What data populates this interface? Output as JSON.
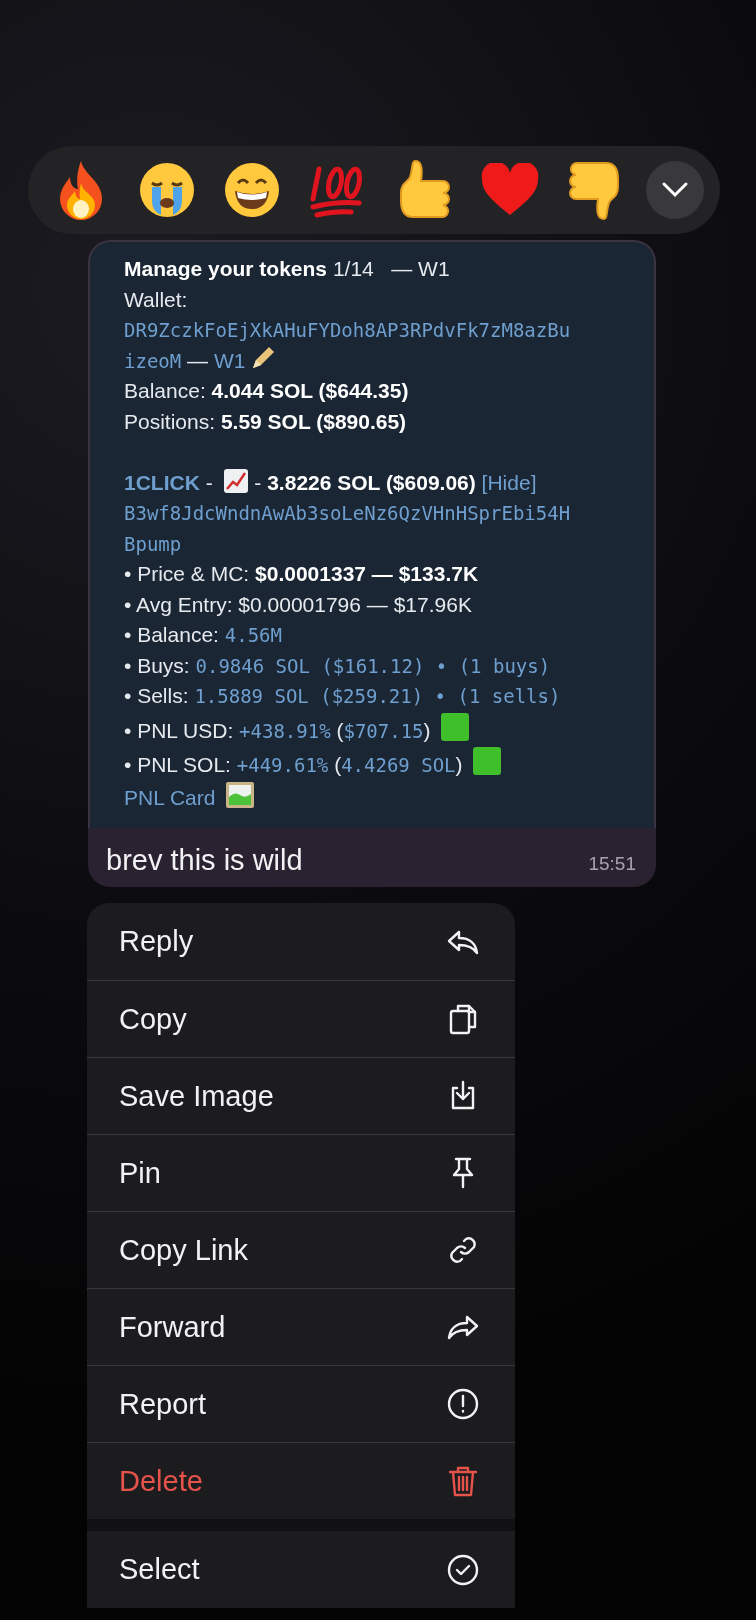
{
  "reactions": [
    {
      "kind": "fire"
    },
    {
      "kind": "crying"
    },
    {
      "kind": "grin"
    },
    {
      "kind": "hundred"
    },
    {
      "kind": "thumbs-up"
    },
    {
      "kind": "heart"
    },
    {
      "kind": "thumbs-down"
    }
  ],
  "message": {
    "image_paragraphs": [
      [
        [
          {
            "kind": "bold",
            "text": "Manage your tokens"
          },
          {
            "kind": "plain",
            "text": " 1/14   — W1"
          }
        ],
        [
          {
            "kind": "plain",
            "text": "Wallet:"
          }
        ],
        [
          {
            "kind": "code",
            "text": "DR9ZczkFoEjXkAHuFYDoh8AP3RPdvFk7zM8azBuizeoM"
          },
          {
            "kind": "plain",
            "text": " — "
          },
          {
            "kind": "link",
            "text": "W1"
          },
          {
            "kind": "pencil"
          }
        ],
        [
          {
            "kind": "plain",
            "text": "Balance: "
          },
          {
            "kind": "bold",
            "text": "4.044 SOL ($644.35)"
          }
        ],
        [
          {
            "kind": "plain",
            "text": "Positions: "
          },
          {
            "kind": "bold",
            "text": "5.59 SOL ($890.65)"
          }
        ]
      ],
      [
        [
          {
            "kind": "link-bold",
            "text": "1CLICK"
          },
          {
            "kind": "plain",
            "text": " - "
          },
          {
            "kind": "chart"
          },
          {
            "kind": "plain",
            "text": " - "
          },
          {
            "kind": "bold",
            "text": "3.8226 SOL ($609.06)"
          },
          {
            "kind": "link",
            "text": " [Hide]"
          }
        ],
        [
          {
            "kind": "code",
            "text": "B3wf8JdcWndnAwAb3soLeNz6QzVHnHSprEbi54HBpump"
          }
        ],
        [
          {
            "kind": "plain",
            "text": "• Price & MC: "
          },
          {
            "kind": "bold",
            "text": "$0.0001337 — $133.7K"
          }
        ],
        [
          {
            "kind": "plain",
            "text": "• Avg Entry: $0.00001796 — $17.96K"
          }
        ],
        [
          {
            "kind": "plain",
            "text": "• Balance: "
          },
          {
            "kind": "code",
            "text": "4.56M"
          }
        ],
        [
          {
            "kind": "plain",
            "text": "• Buys: "
          },
          {
            "kind": "code",
            "text": "0.9846 SOL ($161.12) • (1 buys)"
          }
        ],
        [
          {
            "kind": "plain",
            "text": "• Sells: "
          },
          {
            "kind": "code",
            "text": "1.5889 SOL ($259.21) • (1 sells)"
          }
        ],
        [
          {
            "kind": "plain",
            "text": "• PNL USD: "
          },
          {
            "kind": "code",
            "text": "+438.91%"
          },
          {
            "kind": "plain",
            "text": " ("
          },
          {
            "kind": "code",
            "text": "$707.15"
          },
          {
            "kind": "plain",
            "text": ") "
          },
          {
            "kind": "green-square"
          }
        ],
        [
          {
            "kind": "plain",
            "text": "• PNL SOL: "
          },
          {
            "kind": "code",
            "text": "+449.61%"
          },
          {
            "kind": "plain",
            "text": " ("
          },
          {
            "kind": "code",
            "text": "4.4269 SOL"
          },
          {
            "kind": "plain",
            "text": ") "
          },
          {
            "kind": "green-square"
          }
        ],
        [
          {
            "kind": "link",
            "text": "PNL Card "
          },
          {
            "kind": "picture"
          }
        ]
      ]
    ],
    "caption": "brev this is wild",
    "time": "15:51"
  },
  "menu": [
    {
      "label": "Reply",
      "kind": "reply",
      "danger": false
    },
    {
      "label": "Copy",
      "kind": "copy",
      "danger": false
    },
    {
      "label": "Save Image",
      "kind": "save",
      "danger": false
    },
    {
      "label": "Pin",
      "kind": "pin",
      "danger": false
    },
    {
      "label": "Copy Link",
      "kind": "link",
      "danger": false
    },
    {
      "label": "Forward",
      "kind": "forward",
      "danger": false
    },
    {
      "label": "Report",
      "kind": "report",
      "danger": false
    },
    {
      "label": "Delete",
      "kind": "delete",
      "danger": true
    }
  ],
  "menu_extra": [
    {
      "label": "Select",
      "kind": "select",
      "danger": false
    }
  ]
}
